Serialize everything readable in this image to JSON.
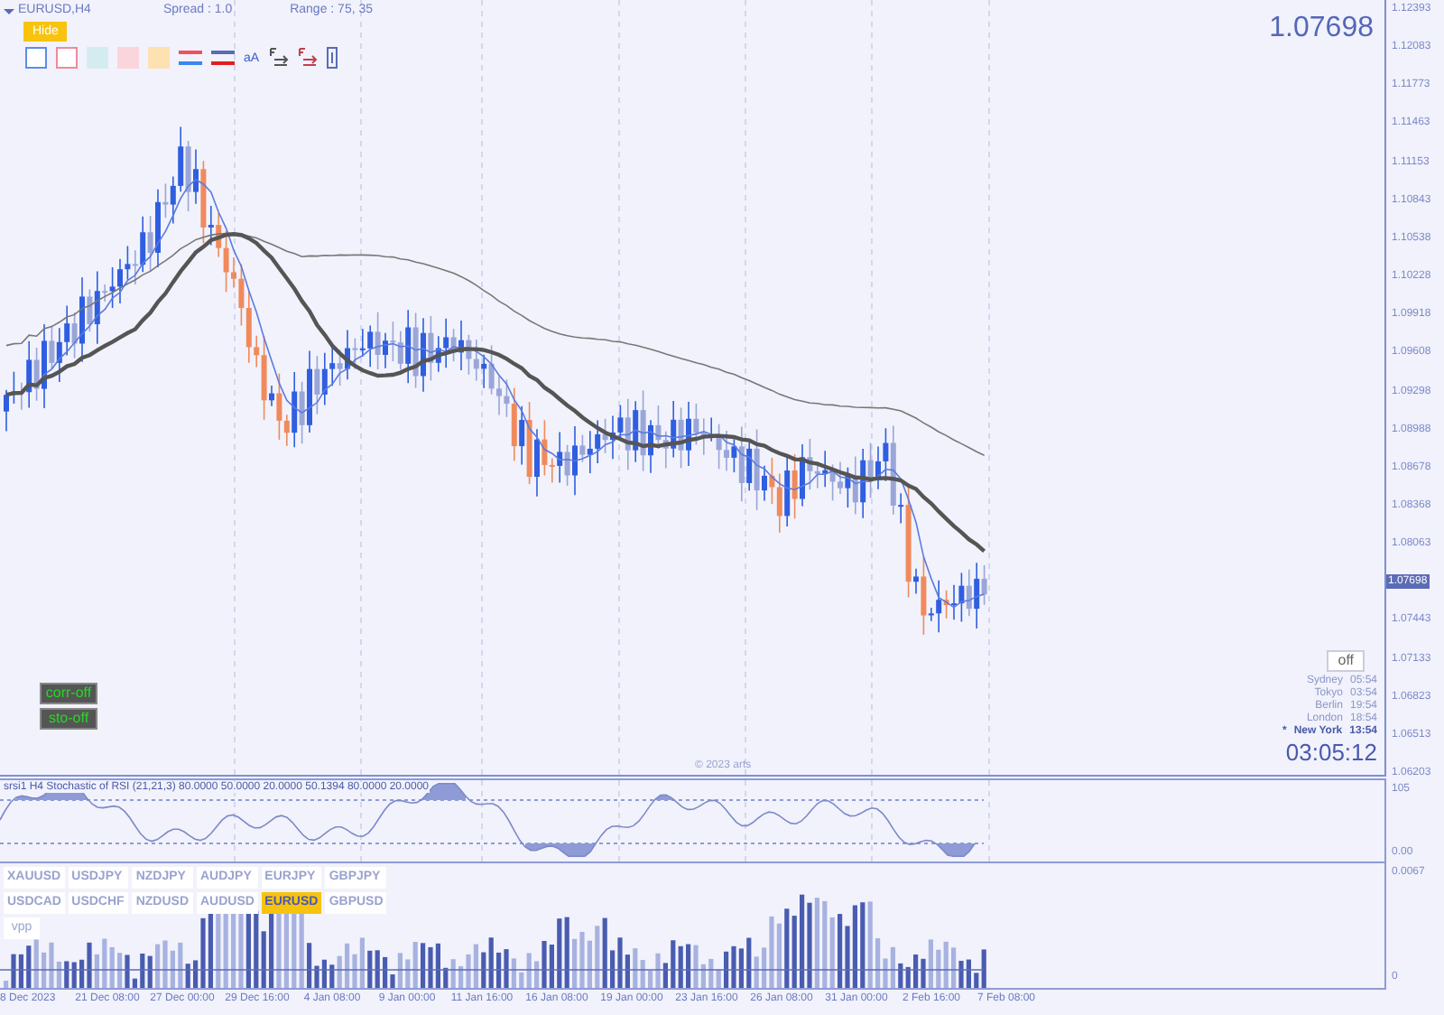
{
  "header": {
    "symbol": "EURUSD,H4",
    "spread": "Spread : 1.0",
    "range": "Range : 75, 35"
  },
  "hide_button": "Hide",
  "font_tool": "aA",
  "current_price": "1.07698",
  "price_axis": [
    {
      "label": "1.12393",
      "kind": "tick"
    },
    {
      "label": "1.12083",
      "kind": "tick"
    },
    {
      "label": "1.11773",
      "kind": "tick"
    },
    {
      "label": "1.11463",
      "kind": "tick"
    },
    {
      "label": "1.11153",
      "kind": "tick"
    },
    {
      "label": "1.10843",
      "kind": "tick"
    },
    {
      "label": "1.10538",
      "kind": "tick"
    },
    {
      "label": "1.10228",
      "kind": "tick"
    },
    {
      "label": "1.09918",
      "kind": "tick"
    },
    {
      "label": "1.09608",
      "kind": "tick"
    },
    {
      "label": "1.09298",
      "kind": "tick"
    },
    {
      "label": "1.08988",
      "kind": "tick"
    },
    {
      "label": "1.08678",
      "kind": "tick"
    },
    {
      "label": "1.08368",
      "kind": "tick"
    },
    {
      "label": "1.08063",
      "kind": "tick"
    },
    {
      "label": "1.07698",
      "kind": "tag"
    },
    {
      "label": "1.07443",
      "kind": "tick"
    },
    {
      "label": "1.07133",
      "kind": "tick"
    },
    {
      "label": "1.06823",
      "kind": "tick"
    },
    {
      "label": "1.06513",
      "kind": "tick"
    },
    {
      "label": "1.06203",
      "kind": "tick"
    }
  ],
  "copyright": "© 2023 arts",
  "buttons": [
    "corr-off",
    "sto-off"
  ],
  "clock": {
    "toggle": "off",
    "sessions": [
      {
        "city": "Sydney",
        "time": "05:54",
        "selected": false
      },
      {
        "city": "Tokyo",
        "time": "03:54",
        "selected": false
      },
      {
        "city": "Berlin",
        "time": "19:54",
        "selected": false
      },
      {
        "city": "London",
        "time": "18:54",
        "selected": false
      },
      {
        "star": "*",
        "city": "New York",
        "time": "13:54",
        "selected": true
      }
    ],
    "countdown": "03:05:12"
  },
  "stochastic": {
    "label": "srsi1 H4 Stochastic of RSI (21,21,3) 80.0000 50.0000 20.0000 50.1394 80.0000 20.0000",
    "axis": [
      "105",
      "0.00"
    ]
  },
  "symbols": [
    {
      "label": "XAUUSD",
      "selected": false
    },
    {
      "label": "USDJPY",
      "selected": false
    },
    {
      "label": "NZDJPY",
      "selected": false
    },
    {
      "label": "AUDJPY",
      "selected": false
    },
    {
      "label": "EURJPY",
      "selected": false
    },
    {
      "label": "GBPJPY",
      "selected": false
    },
    {
      "label": "USDCAD",
      "selected": false
    },
    {
      "label": "USDCHF",
      "selected": false
    },
    {
      "label": "NZDUSD",
      "selected": false
    },
    {
      "label": "AUDUSD",
      "selected": false
    },
    {
      "label": "EURUSD",
      "selected": true
    },
    {
      "label": "GBPUSD",
      "selected": false
    }
  ],
  "vpp_button": "vpp",
  "volume": {
    "axis": [
      "0.0067",
      "0"
    ]
  },
  "time_axis": [
    "8 Dec 2023",
    "21 Dec 08:00",
    "27 Dec 00:00",
    "29 Dec 16:00",
    "4 Jan 08:00",
    "9 Jan 00:00",
    "11 Jan 16:00",
    "16 Jan 08:00",
    "19 Jan 00:00",
    "23 Jan 16:00",
    "26 Jan 08:00",
    "31 Jan 00:00",
    "2 Feb 16:00",
    "7 Feb 08:00"
  ]
}
